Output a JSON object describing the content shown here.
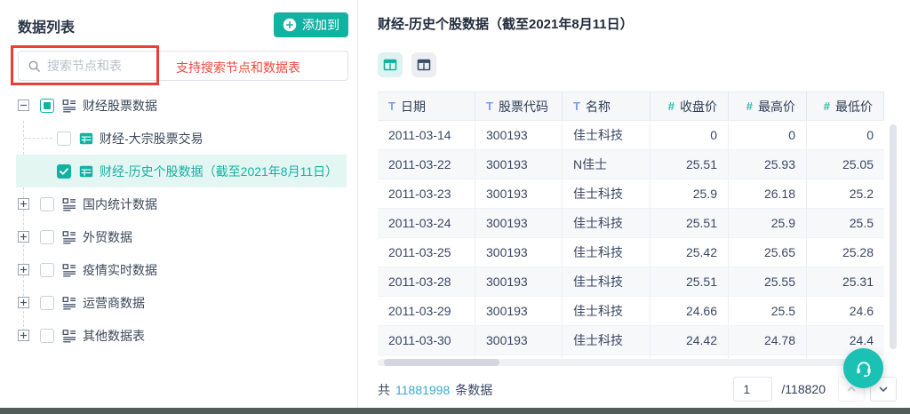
{
  "colors": {
    "teal_primary": "#12b2a3",
    "teal_selected_bg": "#e3f6f2",
    "chat_bubble_teal": "#1bc2b4",
    "annotation_red": "#ea3f33",
    "text_type_icon_blue": "#7e9cec",
    "number_type_icon_teal": "#27bcab",
    "total_count_blue": "#3aa9cf"
  },
  "sidebar": {
    "title": "数据列表",
    "add_button_label": "添加到",
    "search": {
      "placeholder": "搜索节点和表"
    },
    "annotation_hint": "支持搜索节点和数据表",
    "tree": [
      {
        "label": "财经股票数据",
        "kind": "node",
        "expander": "minus",
        "checkbox": "indeterminate",
        "selected": false
      },
      {
        "label": "财经-大宗股票交易",
        "kind": "table",
        "expander": "none",
        "checkbox": "unchecked",
        "selected": false
      },
      {
        "label": "财经-历史个股数据（截至2021年8月11日）",
        "kind": "table",
        "expander": "none",
        "checkbox": "checked",
        "selected": true
      },
      {
        "label": "国内统计数据",
        "kind": "node",
        "expander": "plus",
        "checkbox": "unchecked",
        "selected": false
      },
      {
        "label": "外贸数据",
        "kind": "node",
        "expander": "plus",
        "checkbox": "unchecked",
        "selected": false
      },
      {
        "label": "疫情实时数据",
        "kind": "node",
        "expander": "plus",
        "checkbox": "unchecked",
        "selected": false
      },
      {
        "label": "运营商数据",
        "kind": "node",
        "expander": "plus",
        "checkbox": "unchecked",
        "selected": false
      },
      {
        "label": "其他数据表",
        "kind": "node",
        "expander": "plus",
        "checkbox": "unchecked",
        "selected": false
      }
    ]
  },
  "main": {
    "title": "财经-历史个股数据（截至2021年8月11日）",
    "view_toggles": [
      {
        "name": "table-view",
        "active": true
      },
      {
        "name": "layout-view",
        "active": false
      }
    ],
    "table": {
      "columns": [
        {
          "label": "日期",
          "type": "text"
        },
        {
          "label": "股票代码",
          "type": "text"
        },
        {
          "label": "名称",
          "type": "text"
        },
        {
          "label": "收盘价",
          "type": "number"
        },
        {
          "label": "最高价",
          "type": "number"
        },
        {
          "label": "最低价",
          "type": "number"
        }
      ],
      "rows": [
        [
          "2011-03-14",
          "300193",
          "佳士科技",
          "0",
          "0",
          "0"
        ],
        [
          "2011-03-22",
          "300193",
          "N佳士",
          "25.51",
          "25.93",
          "25.05"
        ],
        [
          "2011-03-23",
          "300193",
          "佳士科技",
          "25.9",
          "26.18",
          "25.2"
        ],
        [
          "2011-03-24",
          "300193",
          "佳士科技",
          "25.51",
          "25.9",
          "25.5"
        ],
        [
          "2011-03-25",
          "300193",
          "佳士科技",
          "25.42",
          "25.65",
          "25.28"
        ],
        [
          "2011-03-28",
          "300193",
          "佳士科技",
          "25.51",
          "25.55",
          "25.31"
        ],
        [
          "2011-03-29",
          "300193",
          "佳士科技",
          "24.66",
          "25.5",
          "24.6"
        ],
        [
          "2011-03-30",
          "300193",
          "佳士科技",
          "24.42",
          "24.78",
          "24.4"
        ]
      ]
    },
    "footer": {
      "total_prefix": "共",
      "total_count": "11881998",
      "total_suffix": "条数据",
      "page_value": "1",
      "page_total": "/118820"
    }
  }
}
